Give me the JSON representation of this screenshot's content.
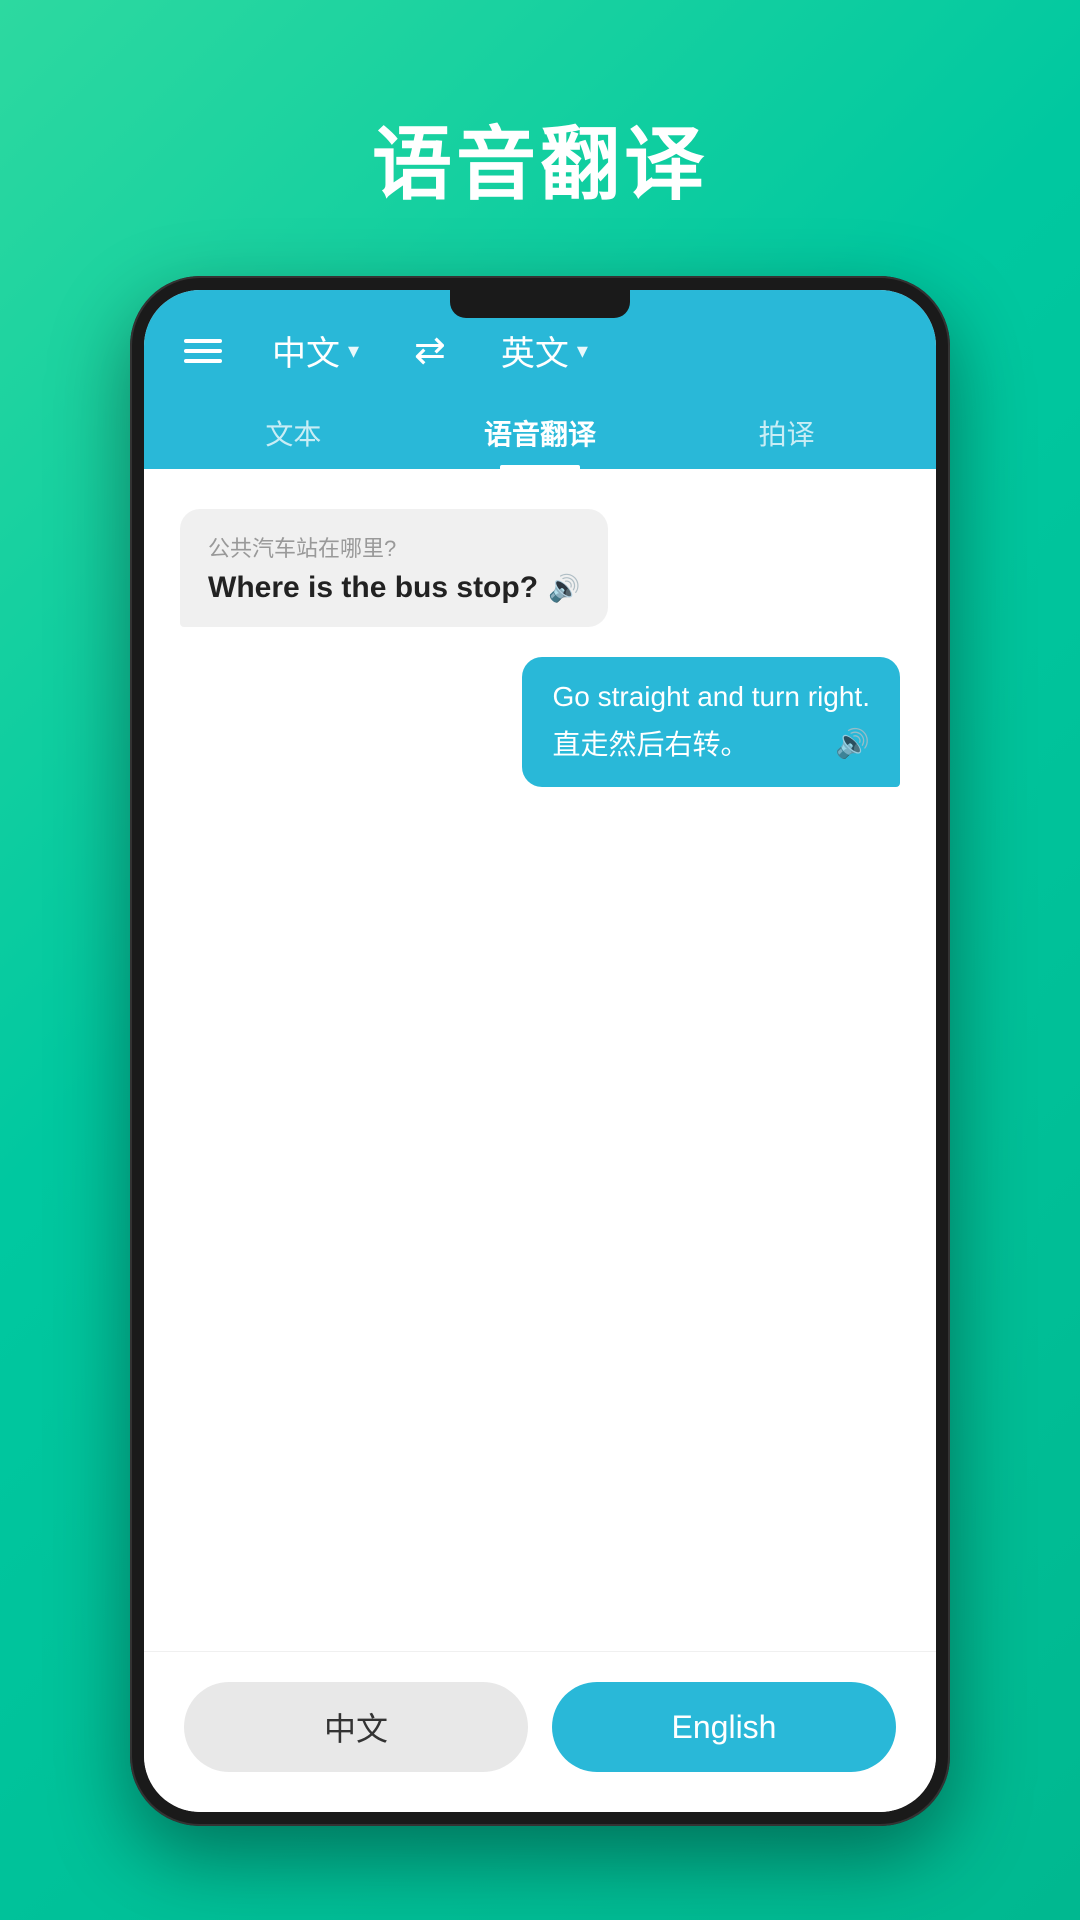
{
  "page": {
    "title": "语音翻译",
    "background_color": "#1ac995"
  },
  "header": {
    "source_lang": "中文",
    "target_lang": "英文",
    "arrow_symbol": "⇄"
  },
  "tabs": [
    {
      "label": "文本",
      "active": false
    },
    {
      "label": "语音翻译",
      "active": true
    },
    {
      "label": "拍译",
      "active": false
    }
  ],
  "messages": [
    {
      "direction": "left",
      "sub_text": "公共汽车站在哪里?",
      "main_text": "Where is the bus stop?",
      "sound": "🔊"
    },
    {
      "direction": "right",
      "main_text_en": "Go straight and turn right.",
      "main_text_zh": "直走然后右转。",
      "sound": "🔊"
    }
  ],
  "bottom_buttons": {
    "chinese_label": "中文",
    "english_label": "English"
  }
}
